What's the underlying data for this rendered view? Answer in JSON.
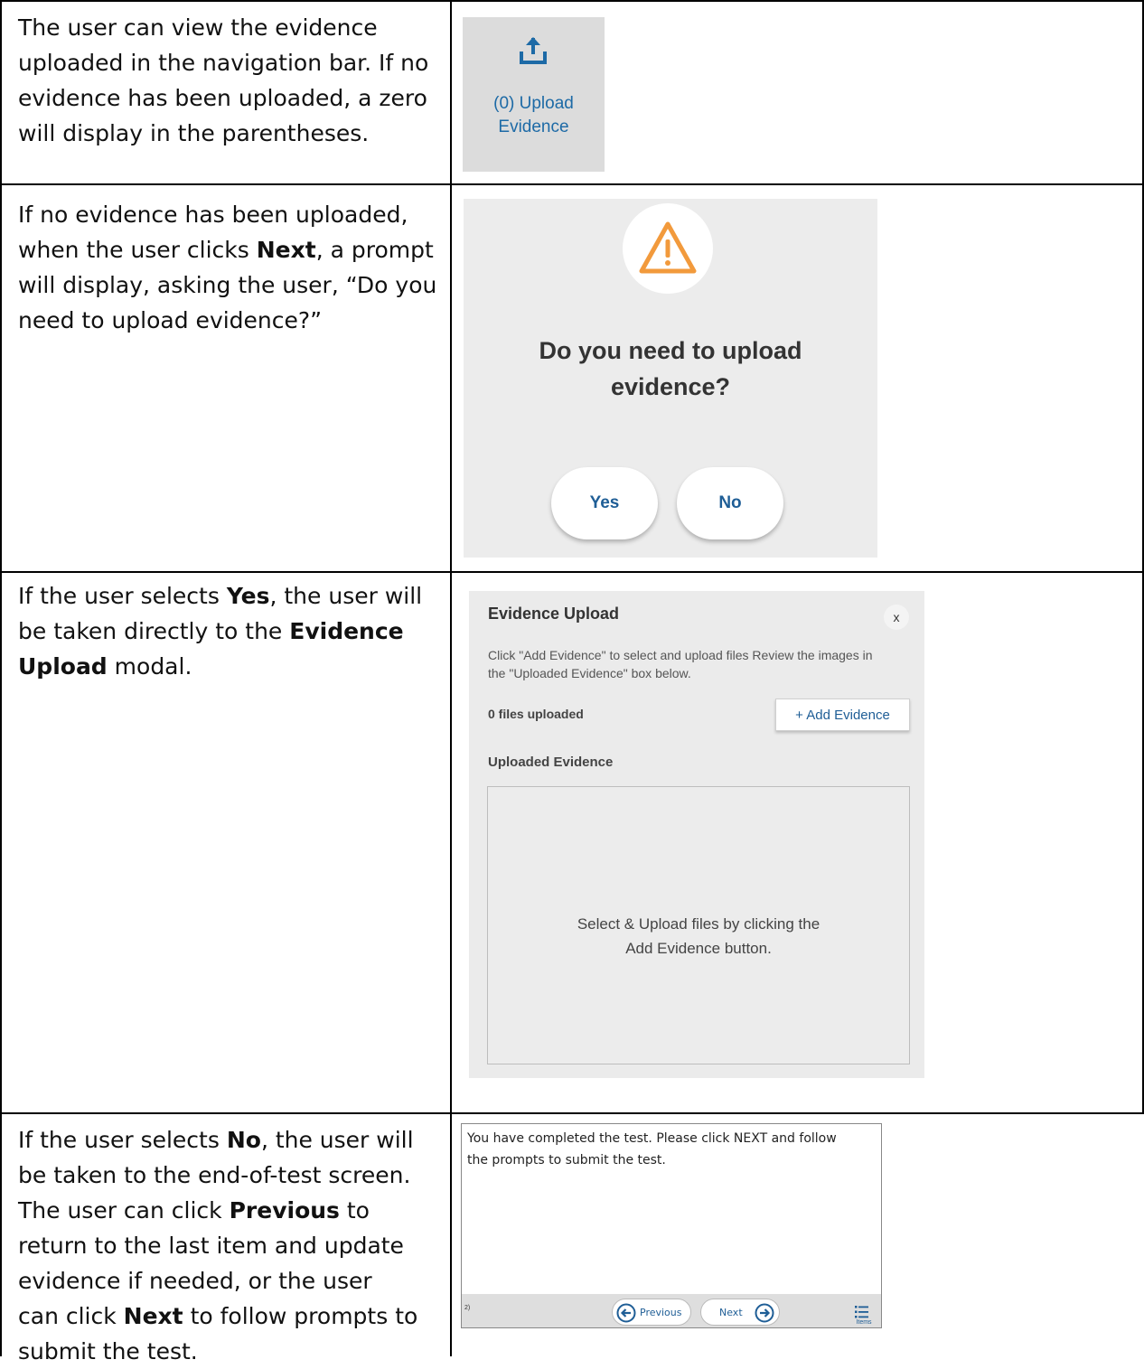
{
  "rows": [
    {
      "lines": [
        "The user can view the evidence",
        "uploaded in the navigation bar. If no",
        "evidence has been uploaded, a zero",
        "will display in the parentheses."
      ]
    },
    {
      "lines": [
        "If no evidence has been uploaded,",
        "when the user clicks ",
        "Next",
        ", a prompt",
        "will display, asking the user, “Do you",
        "need to upload evidence?”"
      ]
    },
    {
      "lines": [
        "If the user selects ",
        "Yes",
        ", the user will",
        "be taken directly to the ",
        "Evidence",
        "Upload",
        " modal."
      ]
    },
    {
      "lines": [
        "If the user selects ",
        "No",
        ", the user will",
        "be taken to the end-of-test screen.",
        "The user can click ",
        "Previous",
        " to",
        "return to the last item and update",
        "evidence if needed, or the user",
        "can click ",
        "Next",
        " to follow prompts to",
        "submit the test."
      ]
    }
  ],
  "upload_tile": {
    "icon": "upload-icon",
    "label_line1": "(0) Upload",
    "label_line2": "Evidence"
  },
  "prompt": {
    "icon": "warning-icon",
    "question_line1": "Do you need to upload",
    "question_line2": "evidence?",
    "yes_label": "Yes",
    "no_label": "No"
  },
  "modal": {
    "title": "Evidence Upload",
    "close_label": "x",
    "instructions_line1": "Click \"Add Evidence\" to select and upload files  Review the images in",
    "instructions_line2": "the \"Uploaded Evidence\" box below.",
    "files_count": "0 files uploaded",
    "add_button": "+ Add Evidence",
    "uploaded_label": "Uploaded Evidence",
    "dropzone_line1": "Select & Upload files by clicking the",
    "dropzone_line2": "Add Evidence button."
  },
  "end_of_test": {
    "message_line1": "You have completed the test. Please click NEXT and follow",
    "message_line2": "the prompts to submit the test.",
    "page_marker": "2)",
    "previous_label": "Previous",
    "next_label": "Next",
    "items_label": "Items"
  },
  "colors": {
    "link_blue": "#1f5e96",
    "warning_orange": "#f29a3c",
    "tile_gray": "#dcdcdc"
  }
}
